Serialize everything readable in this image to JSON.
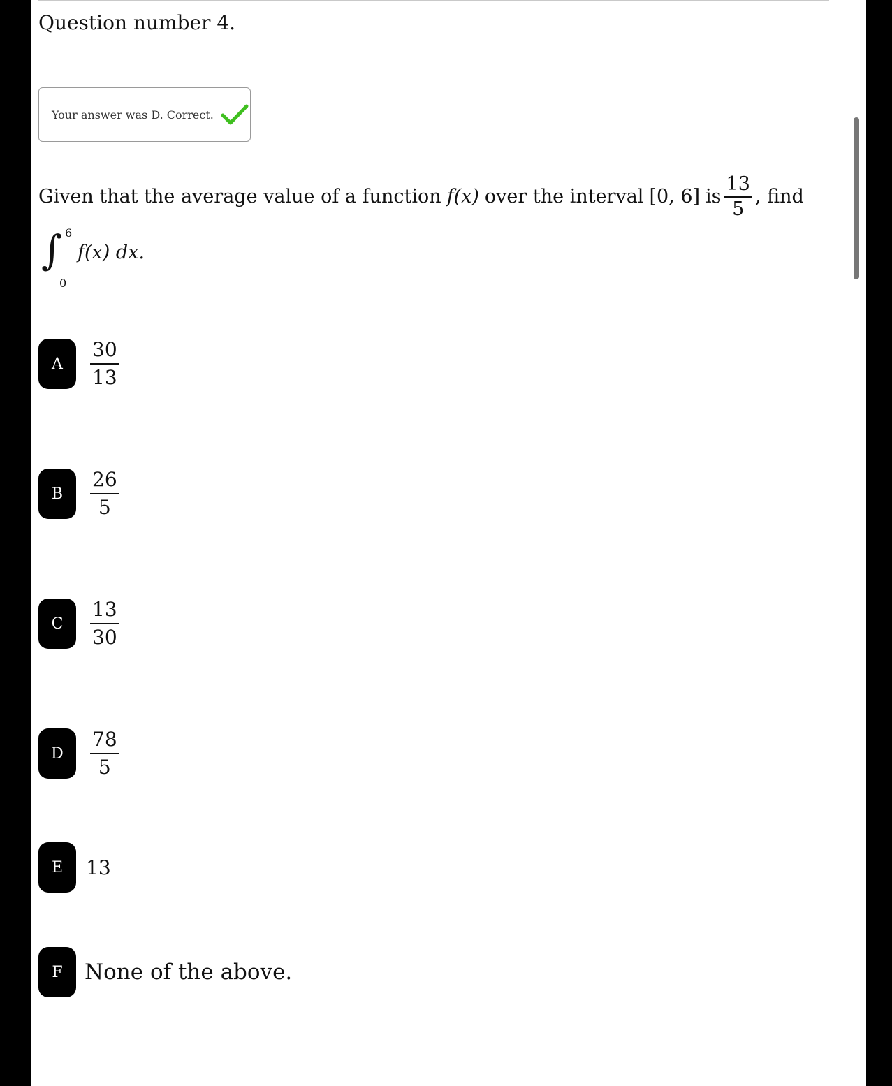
{
  "question": {
    "number_label": "Question number 4.",
    "feedback_text": "Your answer was D. Correct.",
    "feedback_icon": "check-icon",
    "feedback_icon_color": "#3fbf1f",
    "prompt_before_f": "Given that the average value of a function",
    "function_expr": "f(x)",
    "prompt_middle": "over the interval",
    "interval": "[0, 6]",
    "prompt_is": "is",
    "avg_numerator": "13",
    "avg_denominator": "5",
    "prompt_end": ", find",
    "integral_upper": "6",
    "integral_lower": "0",
    "integrand": "f(x) dx."
  },
  "choices": [
    {
      "letter": "A",
      "numerator": "30",
      "denominator": "13"
    },
    {
      "letter": "B",
      "numerator": "26",
      "denominator": "5"
    },
    {
      "letter": "C",
      "numerator": "13",
      "denominator": "30"
    },
    {
      "letter": "D",
      "numerator": "78",
      "denominator": "5"
    },
    {
      "letter": "E",
      "text": "13"
    },
    {
      "letter": "F",
      "text": "None of the above."
    }
  ]
}
